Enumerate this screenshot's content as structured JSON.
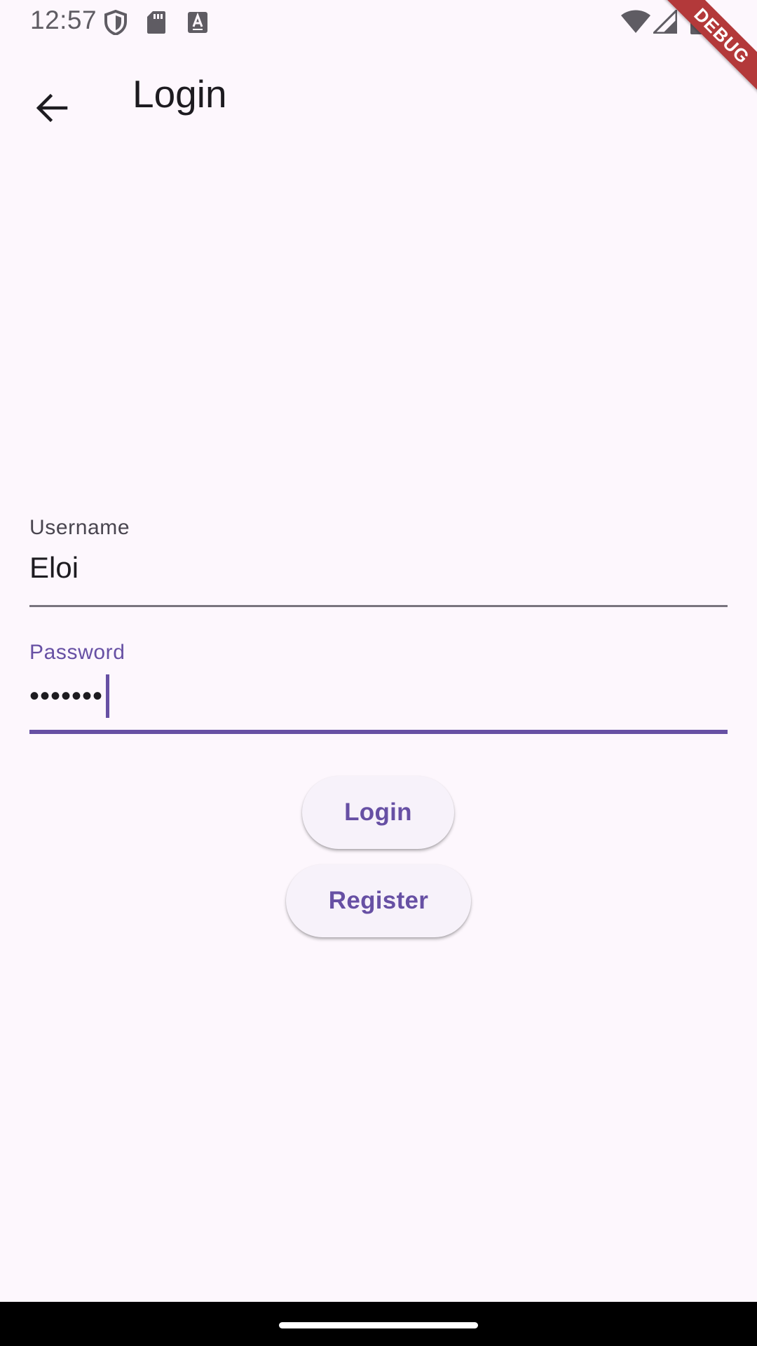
{
  "status_bar": {
    "time": "12:57",
    "left_icons": [
      "shield-icon",
      "sd-card-icon",
      "keyboard-a-icon"
    ],
    "right_icons": [
      "wifi-icon",
      "signal-icon",
      "battery-icon"
    ]
  },
  "app_bar": {
    "back_icon": "arrow-back-icon",
    "title": "Login"
  },
  "debug_banner": {
    "label": "DEBUG"
  },
  "form": {
    "username": {
      "label": "Username",
      "value": "Eloi"
    },
    "password": {
      "label": "Password",
      "masked_value": "•••••••"
    }
  },
  "buttons": {
    "login_label": "Login",
    "register_label": "Register"
  },
  "colors": {
    "background": "#fdf7fd",
    "primary": "#6750a4",
    "on_surface": "#1d1b20",
    "on_surface_variant": "#49454f",
    "outline": "#79747e",
    "button_surface": "#f7f2fa",
    "debug_banner": "#b3393a"
  }
}
